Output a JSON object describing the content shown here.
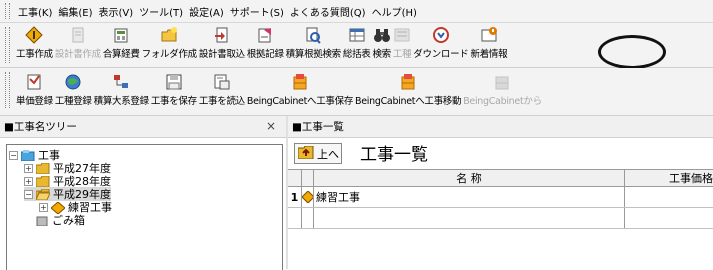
{
  "menu": [
    "工事(K)",
    "編集(E)",
    "表示(V)",
    "ツール(T)",
    "設定(A)",
    "サポート(S)",
    "よくある質問(Q)",
    "ヘルプ(H)"
  ],
  "toolbar1": [
    {
      "label": "工事作成",
      "icon": "construction-sign-icon",
      "disabled": false
    },
    {
      "label": "設計書作成",
      "icon": "document-icon",
      "disabled": true
    },
    {
      "label": "合算経費",
      "icon": "sum-cost-icon",
      "disabled": false
    },
    {
      "label": "フォルダ作成",
      "icon": "new-folder-icon",
      "disabled": false
    },
    {
      "label": "設計書取込",
      "icon": "import-icon",
      "disabled": false
    },
    {
      "label": "根拠記録",
      "icon": "record-icon",
      "disabled": false
    },
    {
      "label": "積算根拠検索",
      "icon": "search-document-icon",
      "disabled": false
    },
    {
      "label": "総括表",
      "icon": "summary-table-icon",
      "disabled": false
    },
    {
      "label": "検索",
      "icon": "binoculars-icon",
      "disabled": false
    },
    {
      "label": "工種",
      "icon": "work-type-icon",
      "disabled": true
    },
    {
      "label": "ダウンロード",
      "icon": "download-icon",
      "disabled": false
    },
    {
      "label": "新着情報",
      "icon": "news-icon",
      "disabled": false
    }
  ],
  "toolbar2": [
    {
      "label": "単価登録",
      "icon": "unit-price-icon",
      "disabled": false
    },
    {
      "label": "工種登録",
      "icon": "globe-icon",
      "disabled": false
    },
    {
      "label": "積算大系登録",
      "icon": "hierarchy-icon",
      "disabled": false
    },
    {
      "label": "工事を保存",
      "icon": "save-icon",
      "disabled": false
    },
    {
      "label": "工事を読込",
      "icon": "load-icon",
      "disabled": false
    },
    {
      "label": "BeingCabinetへ工事保存",
      "icon": "cabinet-save-icon",
      "disabled": false
    },
    {
      "label": "BeingCabinetへ工事移動",
      "icon": "cabinet-move-icon",
      "disabled": false
    },
    {
      "label": "BeingCabinetから",
      "icon": "cabinet-load-icon",
      "disabled": true
    }
  ],
  "left_panel": {
    "title": "■工事名ツリー",
    "close": "×",
    "tree": [
      {
        "label": "工事",
        "expander": "−"
      },
      {
        "label": "平成27年度",
        "expander": "+"
      },
      {
        "label": "平成28年度",
        "expander": "+"
      },
      {
        "label": "平成29年度",
        "expander": "−"
      },
      {
        "label": "練習工事",
        "expander": "+"
      },
      {
        "label": "ごみ箱",
        "expander": ""
      }
    ]
  },
  "right_panel": {
    "title": "■工事一覧",
    "up_label": "上へ",
    "list_title": "工事一覧",
    "columns": [
      "名 称",
      "工事価格"
    ],
    "rows": [
      {
        "no": "1",
        "name": "練習工事"
      }
    ]
  },
  "colors": {
    "folder": "#e8b830",
    "ring": "#111111",
    "accent": "#e07b00"
  }
}
